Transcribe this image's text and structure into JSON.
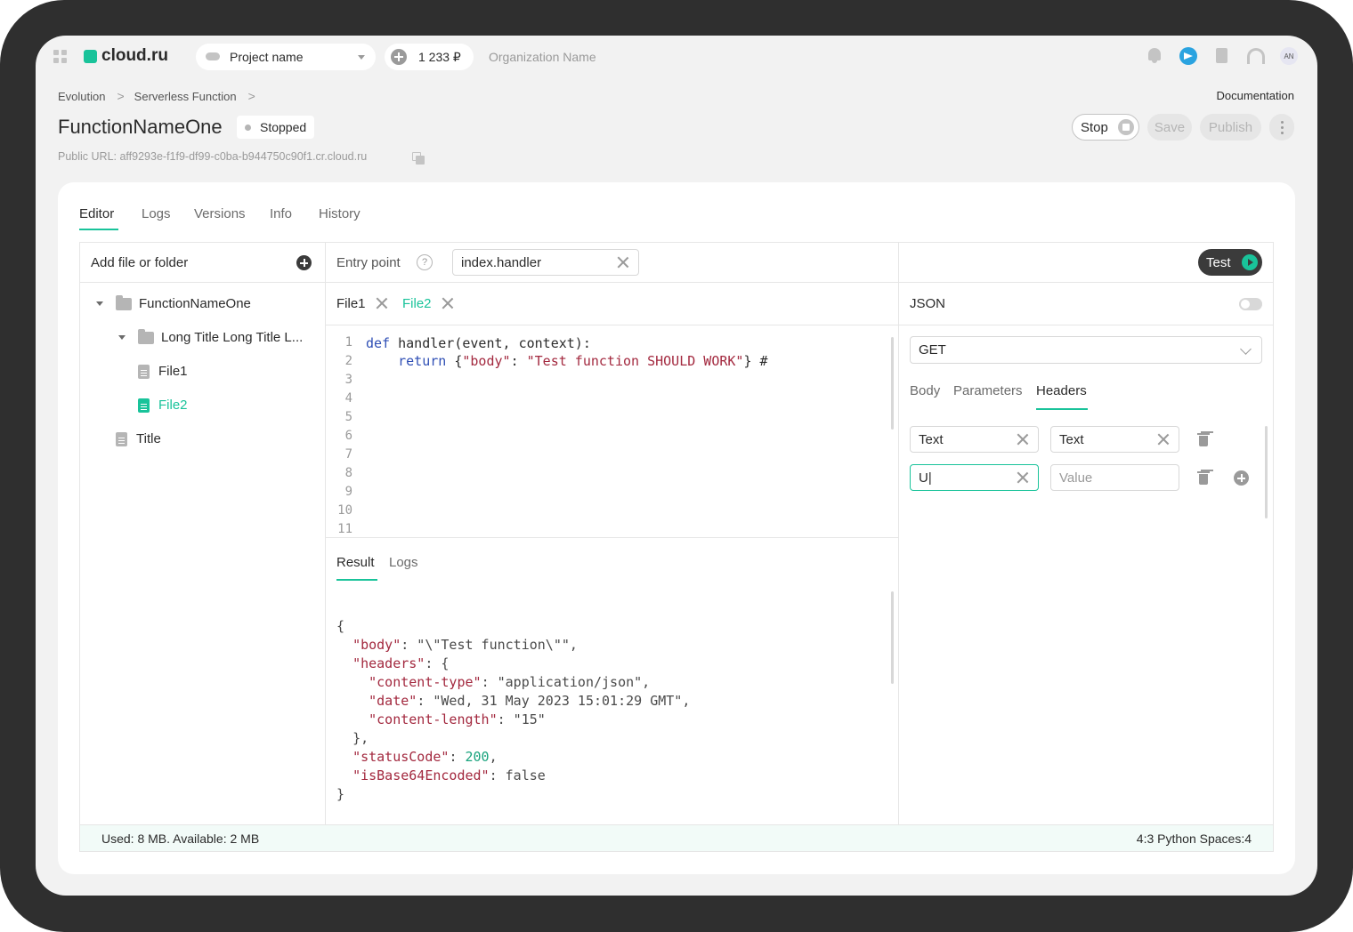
{
  "topbar": {
    "brand": "cloud.ru",
    "project_select": "Project name",
    "balance": "1 233 ₽",
    "organization": "Organization Name",
    "avatar_initials": "AN"
  },
  "breadcrumb": {
    "items": [
      "Evolution",
      "Serverless Function"
    ],
    "documentation": "Documentation"
  },
  "function": {
    "name": "FunctionNameOne",
    "status": "Stopped",
    "public_url": "Public URL: aff9293e-f1f9-df99-c0ba-b944750c90f1.cr.cloud.ru"
  },
  "actions": {
    "stop": "Stop",
    "save": "Save",
    "publish": "Publish"
  },
  "tabs": [
    "Editor",
    "Logs",
    "Versions",
    "Info",
    "History"
  ],
  "file_panel": {
    "add_label": "Add file or folder",
    "tree": [
      "FunctionNameOne",
      "Long Title Long Title L...",
      "File1",
      "File2",
      "Title"
    ]
  },
  "entry": {
    "label": "Entry point",
    "value": "index.handler"
  },
  "file_tabs": [
    "File1",
    "File2"
  ],
  "code": {
    "line_numbers": [
      "1",
      "2",
      "3",
      "4",
      "5",
      "6",
      "7",
      "8",
      "9",
      "10",
      "11"
    ],
    "line1": [
      "def",
      " handler(event, context):"
    ],
    "line2": [
      "    ",
      "return",
      " {",
      "\"body\"",
      ": ",
      "\"Test function SHOULD WORK\"",
      "} #"
    ]
  },
  "result_tabs": [
    "Result",
    "Logs"
  ],
  "result": {
    "open": "{",
    "body_key": "\"body\"",
    "body_val": ": \"\\\"Test function\\\"\",",
    "headers_key": "\"headers\"",
    "headers_open": ": {",
    "ct_key": "\"content-type\"",
    "ct_val": ": \"application/json\",",
    "date_key": "\"date\"",
    "date_val": ": \"Wed, 31 May 2023 15:01:29 GMT\",",
    "cl_key": "\"content-length\"",
    "cl_val": ": \"15\"",
    "headers_close": "},",
    "sc_key": "\"statusCode\"",
    "sc_sep": ": ",
    "sc_val": "200",
    "sc_comma": ",",
    "b64_key": "\"isBase64Encoded\"",
    "b64_val": ": false",
    "close": "}"
  },
  "test_panel": {
    "test_button": "Test",
    "json_label": "JSON",
    "method": "GET",
    "subtabs": [
      "Body",
      "Parameters",
      "Headers"
    ],
    "header_rows": [
      {
        "key": "Text",
        "value": "Text"
      },
      {
        "key": "U|",
        "value": ""
      }
    ],
    "value_placeholder": "Value"
  },
  "statusbar": {
    "usage": "Used: 8 MB. Available: 2 MB",
    "cursor": "4:3 Python Spaces:4"
  },
  "colors": {
    "accent": "#19c39a",
    "dark_button": "#3b3b3b",
    "keyword": "#2f4fb5",
    "string": "#a3293f"
  }
}
